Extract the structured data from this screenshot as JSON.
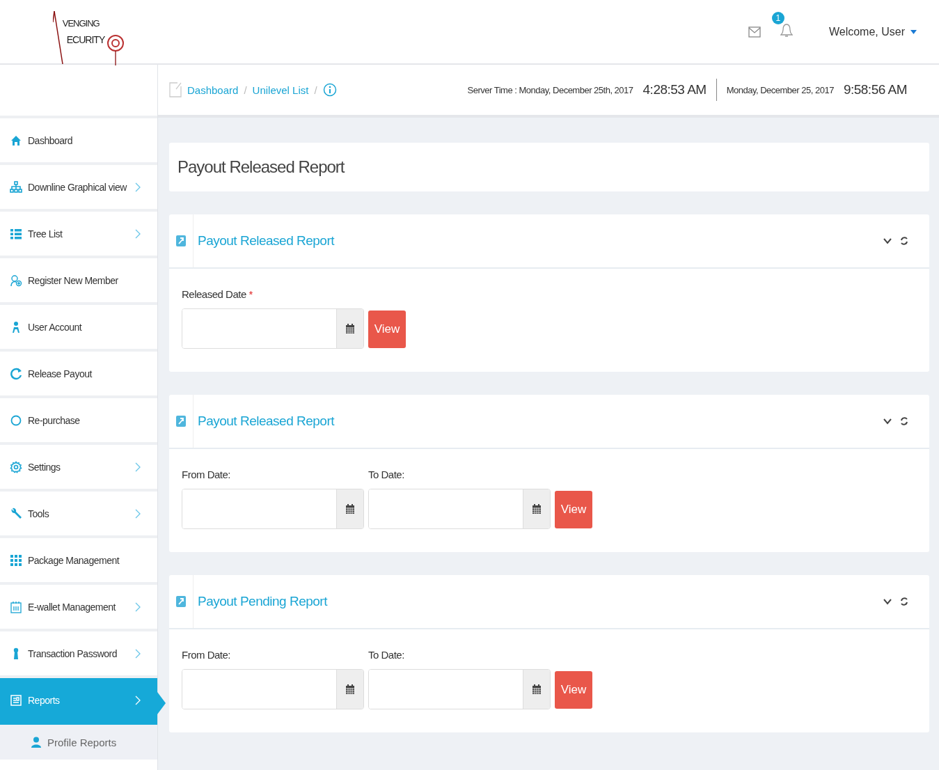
{
  "header": {
    "logo": {
      "line_1": "VENGING",
      "line_2": "ECURITY"
    },
    "notification_count": "1",
    "welcome": "Welcome, User"
  },
  "breadcrumb": {
    "separator": "/",
    "items": [
      "Dashboard",
      "Unilevel List"
    ]
  },
  "clock": {
    "server_label": "Server Time : Monday, December 25th, 2017",
    "server_time": "4:28:53 AM",
    "local_date": "Monday, December 25, 2017",
    "local_time": "9:58:56 AM"
  },
  "sidebar": {
    "items": [
      {
        "label": "Dashboard",
        "submenu": false,
        "selected": false
      },
      {
        "label": "Downline Graphical view",
        "submenu": true,
        "selected": false
      },
      {
        "label": "Tree List",
        "submenu": true,
        "selected": false
      },
      {
        "label": "Register New Member",
        "submenu": false,
        "selected": false
      },
      {
        "label": "User Account",
        "submenu": false,
        "selected": false
      },
      {
        "label": "Release Payout",
        "submenu": false,
        "selected": false
      },
      {
        "label": "Re-purchase",
        "submenu": false,
        "selected": false
      },
      {
        "label": "Settings",
        "submenu": true,
        "selected": false
      },
      {
        "label": "Tools",
        "submenu": true,
        "selected": false
      },
      {
        "label": "Package Management",
        "submenu": false,
        "selected": false
      },
      {
        "label": "E-wallet Management",
        "submenu": true,
        "selected": false
      },
      {
        "label": "Transaction Password",
        "submenu": true,
        "selected": false
      },
      {
        "label": "Reports",
        "submenu": true,
        "selected": true,
        "children": [
          {
            "label": "Profile Reports"
          }
        ]
      }
    ]
  },
  "page_title": "Payout Released Report",
  "panels": [
    {
      "title": "Payout Released Report",
      "fields": [
        {
          "label": "Released Date",
          "required_mark": "*"
        }
      ],
      "button": "View"
    },
    {
      "title": "Payout Released Report",
      "fields": [
        {
          "label": "From Date:"
        },
        {
          "label": "To Date:"
        }
      ],
      "button": "View"
    },
    {
      "title": "Payout Pending Report",
      "fields": [
        {
          "label": "From Date:"
        },
        {
          "label": "To Date:"
        }
      ],
      "button": "View"
    }
  ]
}
